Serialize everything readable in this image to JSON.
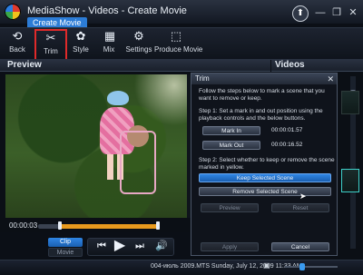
{
  "window": {
    "title": "MediaShow - Videos - Create Movie",
    "tab_label": "Create Movie",
    "minimize": "—",
    "restore": "❐",
    "close": "✕",
    "upgrade_icon": "up-arrow-icon"
  },
  "toolbar": {
    "items": [
      {
        "label": "Back",
        "icon": "back-arrow-icon"
      },
      {
        "label": "Trim",
        "icon": "scissors-icon",
        "selected": true
      },
      {
        "label": "Style",
        "icon": "style-icon"
      },
      {
        "label": "Mix",
        "icon": "mix-icon"
      },
      {
        "label": "Settings",
        "icon": "gear-icon"
      },
      {
        "label": "Produce Movie",
        "icon": "produce-icon"
      }
    ]
  },
  "panels": {
    "preview_title": "Preview",
    "videos_title": "Videos"
  },
  "trim_dialog": {
    "title": "Trim",
    "close": "✕",
    "intro": "Follow the steps below to mark a scene that you want to remove or keep.",
    "step1": "Step 1: Set a mark in and out position using the playback controls and the below buttons.",
    "mark_in_label": "Mark In",
    "mark_in_time": "00:00:01.57",
    "mark_out_label": "Mark Out",
    "mark_out_time": "00:00:16.52",
    "step2": "Step 2: Select whether to keep or remove the scene marked in yellow.",
    "keep_label": "Keep Selected Scene",
    "remove_label": "Remove Selected Scene",
    "preview_label": "Preview",
    "reset_label": "Reset",
    "apply_label": "Apply",
    "cancel_label": "Cancel"
  },
  "timeline": {
    "current_time": "00:00:03",
    "end_time": "",
    "selection_color": "#e89a1e"
  },
  "transport": {
    "clip_label": "Clip",
    "movie_label": "Movie",
    "prev": "⏮",
    "play": "▶",
    "next": "⏭",
    "volume": "🔊"
  },
  "statusbar": {
    "text": "004-июль 2009.MTS  Sunday, July 12, 2009 11:33 AM"
  },
  "colors": {
    "accent": "#2c7cd6",
    "highlight_red": "#e02a2a"
  }
}
